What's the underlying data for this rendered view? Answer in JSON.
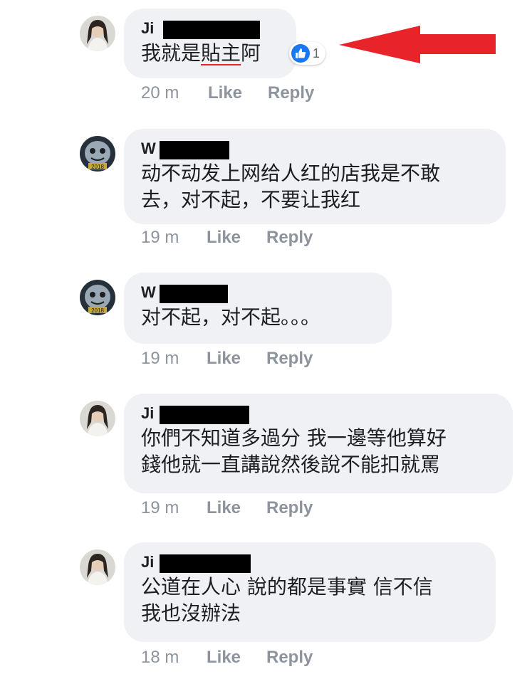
{
  "comments": [
    {
      "author": "Ji",
      "text_lines": [
        "我就是",
        "貼主",
        "阿"
      ],
      "time": "20 m",
      "like": "Like",
      "reply": "Reply",
      "reaction_count": "1"
    },
    {
      "author": "W",
      "text_lines": [
        "动不动发上网给人红的店我是不敢",
        "去，对不起，不要让我红"
      ],
      "time": "19 m",
      "like": "Like",
      "reply": "Reply"
    },
    {
      "author": "W",
      "text_lines": [
        "对不起，对不起。。。"
      ],
      "time": "19 m",
      "like": "Like",
      "reply": "Reply"
    },
    {
      "author": "Ji",
      "text_lines": [
        "你們不知道多過分 我一邊等他算好",
        "錢他就一直講說然後說不能扣就罵"
      ],
      "time": "19 m",
      "like": "Like",
      "reply": "Reply"
    },
    {
      "author": "Ji",
      "text_lines": [
        "公道在人心 說的都是事實 信不信",
        "我也沒辦法"
      ],
      "time": "18 m",
      "like": "Like",
      "reply": "Reply"
    }
  ],
  "colors": {
    "bubble": "#f0f1f4",
    "meta_text": "#8d949e",
    "like_blue": "#1877f2",
    "annotation_red": "#e8232a",
    "redaction": "#000000"
  },
  "icons": {
    "reaction": "thumbs-up-icon",
    "annotation": "red-arrow-left-icon"
  }
}
